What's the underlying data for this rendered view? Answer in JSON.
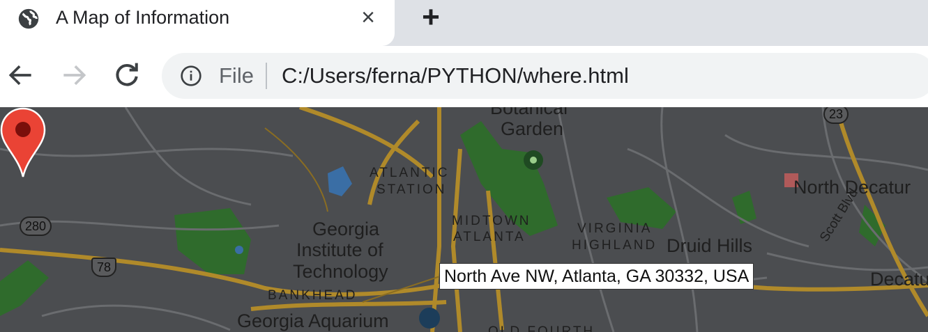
{
  "tab": {
    "title": "A Map of Information",
    "close_symbol": "×",
    "favicon": "globe-icon"
  },
  "new_tab_symbol": "+",
  "toolbar": {
    "back_icon": "back-arrow-icon",
    "forward_icon": "forward-arrow-icon",
    "reload_icon": "reload-icon",
    "site_info_icon": "info-icon",
    "scheme_label": "File",
    "url": "C:/Users/ferna/PYTHON/where.html"
  },
  "map": {
    "labels": {
      "botanical": "Botanical",
      "garden": "Garden",
      "atlantic": "ATLANTIC",
      "station": "STATION",
      "georgia_tech_1": "Georgia",
      "georgia_tech_2": "Institute of",
      "georgia_tech_3": "Technology",
      "midtown": "MIDTOWN",
      "atlanta": "ATLANTA",
      "virginia": "VIRGINIA",
      "highland": "HIGHLAND",
      "druid_hills": "Druid Hills",
      "north_decatur": "North Decatur",
      "decatur": "Decatu",
      "scott_blvd": "Scott Blvd",
      "bankhead": "BANKHEAD",
      "georgia_aquarium": "Georgia Aquarium",
      "old_fourth": "OLD FOURTH"
    },
    "shields": {
      "route_23": "23",
      "route_280": "280",
      "route_78": "78"
    },
    "marker_tooltip": "North Ave NW, Atlanta, GA 30332, USA",
    "colors": {
      "background": "#4b4d50",
      "park": "#2f6b2c",
      "road_major": "#b08a2a",
      "road_minor": "#6a6c6f",
      "water": "#3a6ea5",
      "marker": "#ea4335"
    }
  }
}
